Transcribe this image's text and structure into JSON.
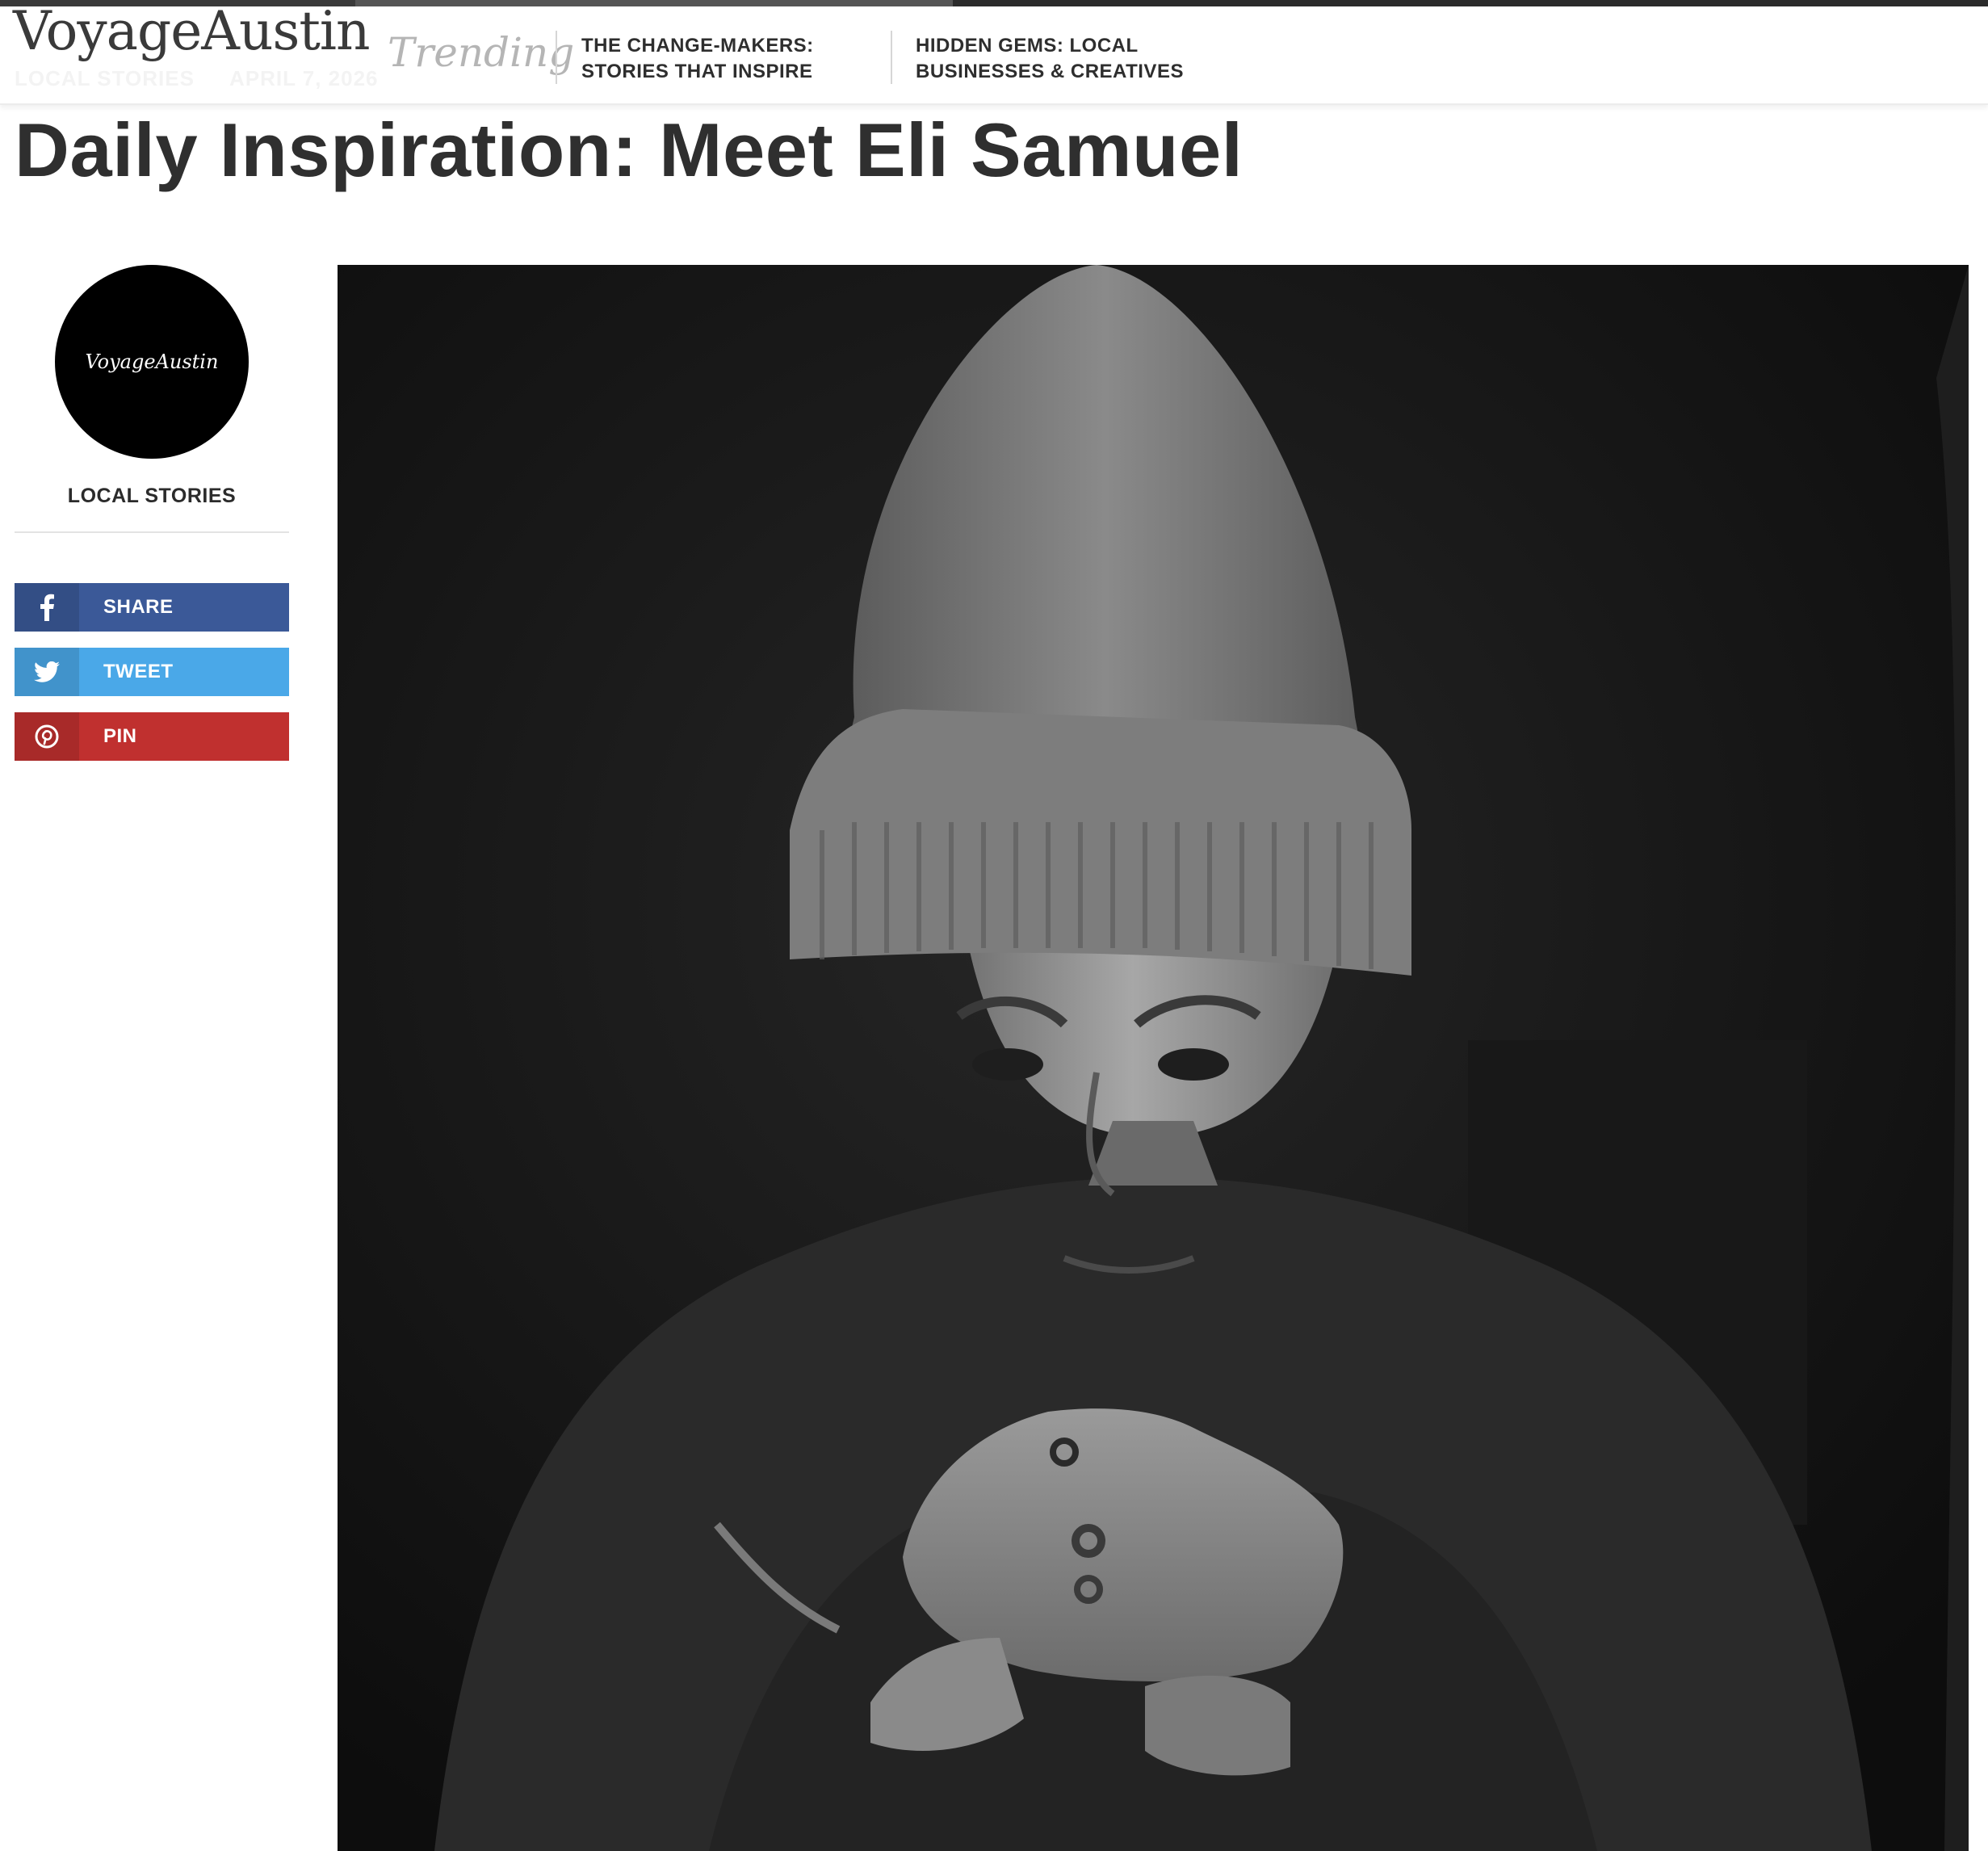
{
  "site": {
    "logo": "VoyageAustin",
    "ghost_category": "LOCAL STORIES",
    "ghost_date": "APRIL 7, 2026"
  },
  "trending": {
    "label": "Trending",
    "items": [
      "THE CHANGE-MAKERS: STORIES THAT INSPIRE",
      "HIDDEN GEMS: LOCAL BUSINESSES & CREATIVES"
    ]
  },
  "article": {
    "title": "Daily Inspiration: Meet Eli Samuel"
  },
  "sidebar": {
    "avatar_text": "VoyageAustin",
    "category": "LOCAL STORIES",
    "share_buttons": [
      {
        "label": "SHARE",
        "icon": "facebook-icon",
        "color": "#3b5998"
      },
      {
        "label": "TWEET",
        "icon": "twitter-icon",
        "color": "#4aa8e8"
      },
      {
        "label": "PIN",
        "icon": "pinterest-icon",
        "color": "#c0302f"
      }
    ]
  },
  "colors": {
    "text": "#2f2f2f",
    "facebook": "#3b5998",
    "twitter": "#4aa8e8",
    "pinterest": "#c0302f"
  }
}
